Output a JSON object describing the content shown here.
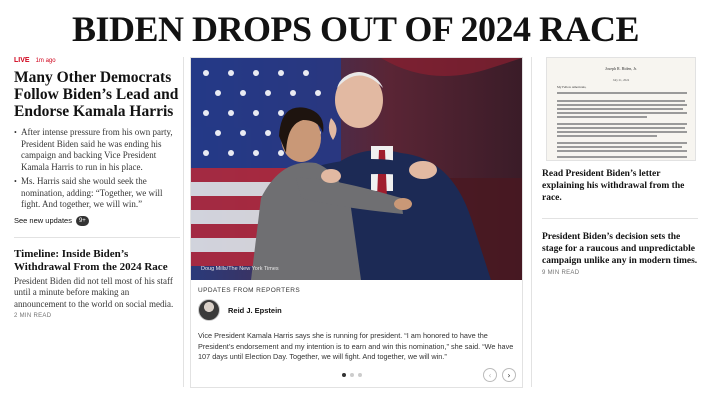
{
  "headline": "BIDEN DROPS OUT OF 2024 RACE",
  "left": {
    "live_label": "LIVE",
    "time_ago": "1m ago",
    "lead_title": "Many Other Democrats Follow Biden’s Lead and Endorse Kamala Harris",
    "bullets": [
      "After intense pressure from his own party, President Biden said he was ending his campaign and backing Vice President Kamala Harris to run in his place.",
      "Ms. Harris said she would seek the nomination, adding: “Together, we will fight. And together, we will win.”"
    ],
    "see_updates": "See new updates",
    "updates_count": "9+",
    "timeline_title": "Timeline: Inside Biden’s Withdrawal From the 2024 Race",
    "timeline_body": "President Biden did not tell most of his staff until a minute before making an announcement to the world on social media.",
    "timeline_read": "2 MIN READ"
  },
  "middle": {
    "photo_credit": "Doug Mills/The New York Times",
    "updates_from": "UPDATES FROM REPORTERS",
    "reporter_name": "Reid J. Epstein",
    "quote": "Vice President Kamala Harris says she is running for president. “I am honored to have the President’s endorsement and my intention is to earn and win this nomination,” she said. “We have 107 days until Election Day. Together, we will fight. And together, we will win.”",
    "prev_icon": "‹",
    "next_icon": "›"
  },
  "right": {
    "letter_head": "Joseph R. Biden, Jr.",
    "letter_date": "July 21, 2024",
    "letter_salutation": "My Fellow Americans,",
    "letter_caption": "Read President Biden’s letter explaining his withdrawal from the race.",
    "story_title": "President Biden’s decision sets the stage for a raucous and unpredictable campaign unlike any in modern times.",
    "story_read": "9 MIN READ"
  },
  "colors": {
    "live_red": "#d0021b",
    "text_dark": "#121212",
    "divider": "#e2e2e2"
  }
}
